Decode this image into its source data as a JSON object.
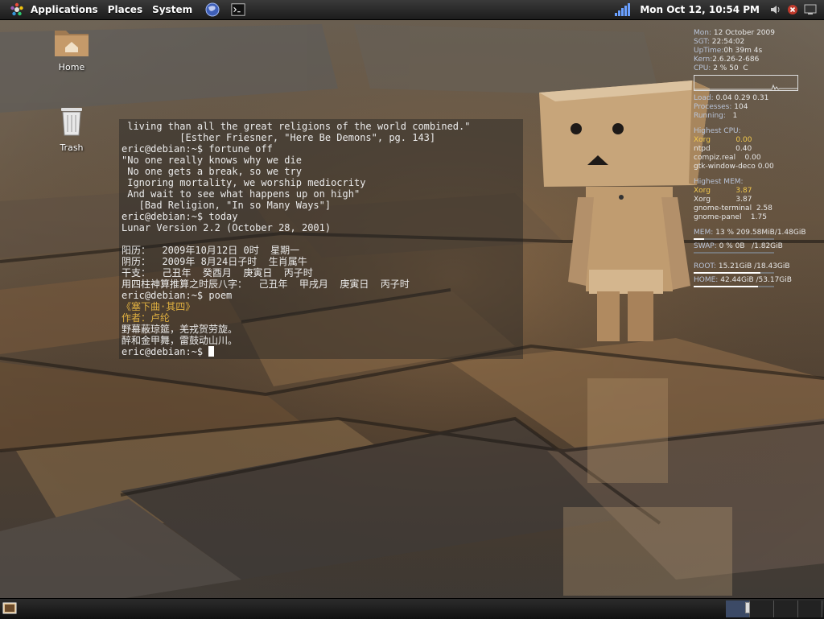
{
  "top_panel": {
    "menus": [
      "Applications",
      "Places",
      "System"
    ],
    "clock": "Mon Oct 12, 10:54 PM"
  },
  "desktop": {
    "icons": [
      {
        "label": "Home",
        "icon": "home-folder-icon"
      },
      {
        "label": "Trash",
        "icon": "trash-icon"
      }
    ]
  },
  "terminal": {
    "lines": [
      " living than all the great religions of the world combined.\"",
      "          [Esther Friesner, \"Here Be Demons\", pg. 143]",
      "eric@debian:~$ fortune off",
      "\"No one really knows why we die",
      " No one gets a break, so we try",
      " Ignoring mortality, we worship mediocrity",
      " And wait to see what happens up on high\"",
      "   [Bad Religion, \"In so Many Ways\"]",
      "eric@debian:~$ today",
      "Lunar Version 2.2 (October 28, 2001)",
      "",
      "阳历：  2009年10月12日 0时  星期一",
      "阴历：  2009年 8月24日子时  生肖属牛",
      "干支：  己丑年  癸酉月  庚寅日  丙子时",
      "用四柱神算推算之时辰八字：  己丑年  甲戌月  庚寅日  丙子时",
      "eric@debian:~$ poem",
      "《塞下曲·其四》",
      "作者：卢纶",
      "野幕蔽琼筵，羌戎贺劳旋。",
      "醉和金甲舞，雷鼓动山川。"
    ],
    "highlight_lines": [
      16,
      17
    ],
    "prompt": "eric@debian:~$ "
  },
  "conky": {
    "date": {
      "k": "Mon:",
      "v": "12 October 2009"
    },
    "time": {
      "k": "SGT:",
      "v": "22:54:02"
    },
    "uptime": {
      "k": "UpTime:",
      "v": "0h 39m 4s"
    },
    "kern": {
      "k": "Kern:",
      "v": "2.6.26-2-686"
    },
    "cpu": {
      "k": "CPU:",
      "v": "2 % 50  C"
    },
    "load": {
      "k": "Load:",
      "v": "0.04 0.29 0.31"
    },
    "processes": {
      "k": "Processes:",
      "v": "104"
    },
    "running": {
      "k": "Running:",
      "v": "1"
    },
    "cpu_heading": "Highest CPU:",
    "cpu_top": [
      {
        "name": "Xorg",
        "val": "0.00"
      },
      {
        "name": "ntpd",
        "val": "0.40"
      },
      {
        "name": "compiz.real",
        "val": "0.00"
      },
      {
        "name": "gtk-window-deco",
        "val": "0.00"
      }
    ],
    "mem_heading": "Highest MEM:",
    "mem_top": [
      {
        "name": "Xorg",
        "val": "3.87"
      },
      {
        "name": "Xorg",
        "val": "3.87"
      },
      {
        "name": "gnome-terminal",
        "val": "2.58"
      },
      {
        "name": "gnome-panel",
        "val": "1.75"
      }
    ],
    "mem": {
      "k": "MEM:",
      "v": "13 % 209.58MiB/1.48GiB",
      "fraction": 0.13
    },
    "swap": {
      "k": "SWAP:",
      "v": "0 % 0B   /1.82GiB",
      "fraction": 0.0
    },
    "root": {
      "k": "ROOT:",
      "v": "15.21GiB /18.43GiB",
      "fraction": 0.83
    },
    "home": {
      "k": "HOME:",
      "v": "42.44GiB /53.17GiB",
      "fraction": 0.8
    }
  },
  "bottom_panel": {
    "workspaces": 4,
    "active_workspace": 1
  }
}
